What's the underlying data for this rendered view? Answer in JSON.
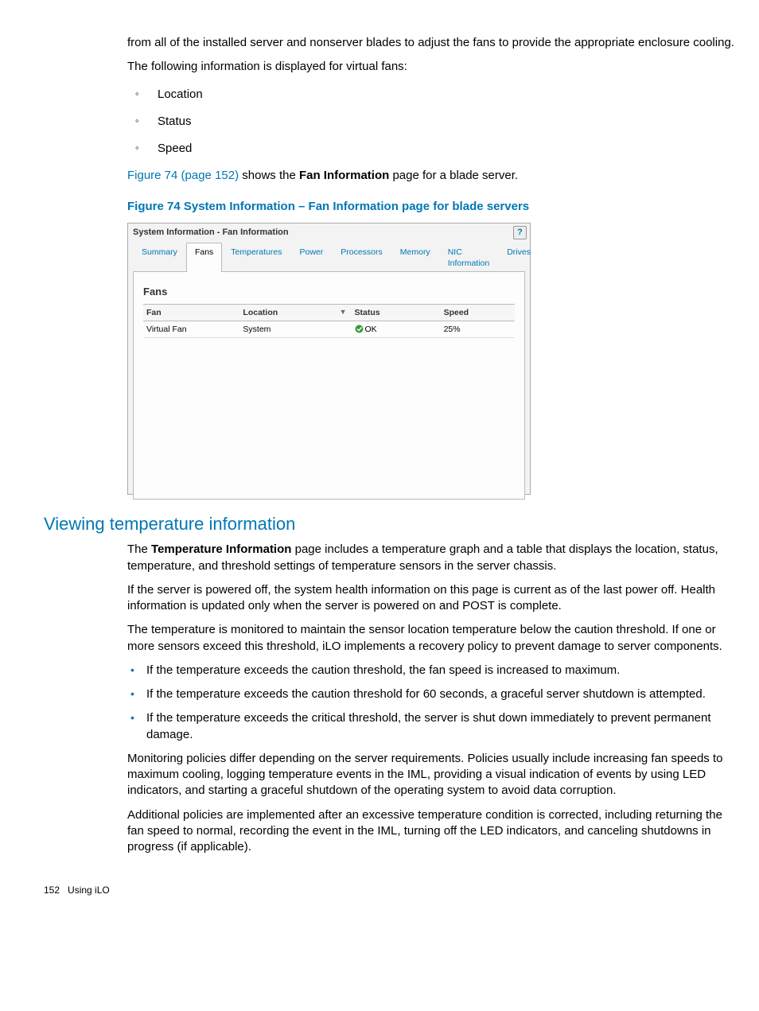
{
  "intro": {
    "p1": "from all of the installed server and nonserver blades to adjust the fans to provide the appropriate enclosure cooling.",
    "p2": "The following information is displayed for virtual fans:",
    "list": [
      "Location",
      "Status",
      "Speed"
    ],
    "p3_pre_link": "",
    "p3_link": "Figure 74 (page 152)",
    "p3_mid": " shows the ",
    "p3_bold": "Fan Information",
    "p3_end": " page for a blade server."
  },
  "figure": {
    "caption": "Figure 74 System Information – Fan Information page for blade servers",
    "title": "System Information - Fan Information",
    "help": "?",
    "tabs": [
      "Summary",
      "Fans",
      "Temperatures",
      "Power",
      "Processors",
      "Memory",
      "NIC Information",
      "Drives"
    ],
    "active_tab_index": 1,
    "section_heading": "Fans",
    "table": {
      "headers": [
        "Fan",
        "Location",
        "Status",
        "Speed"
      ],
      "row": {
        "fan": "Virtual Fan",
        "location": "System",
        "status": "OK",
        "speed": "25%"
      }
    }
  },
  "section": {
    "heading": "Viewing temperature information",
    "p1_pre": "The ",
    "p1_bold": "Temperature Information",
    "p1_post": " page includes a temperature graph and a table that displays the location, status, temperature, and threshold settings of temperature sensors in the server chassis.",
    "p2": "If the server is powered off, the system health information on this page is current as of the last power off. Health information is updated only when the server is powered on and POST is complete.",
    "p3": "The temperature is monitored to maintain the sensor location temperature below the caution threshold. If one or more sensors exceed this threshold, iLO implements a recovery policy to prevent damage to server components.",
    "bullets": [
      "If the temperature exceeds the caution threshold, the fan speed is increased to maximum.",
      "If the temperature exceeds the caution threshold for 60 seconds, a graceful server shutdown is attempted.",
      "If the temperature exceeds the critical threshold, the server is shut down immediately to prevent permanent damage."
    ],
    "p4": "Monitoring policies differ depending on the server requirements. Policies usually include increasing fan speeds to maximum cooling, logging temperature events in the IML, providing a visual indication of events by using LED indicators, and starting a graceful shutdown of the operating system to avoid data corruption.",
    "p5": "Additional policies are implemented after an excessive temperature condition is corrected, including returning the fan speed to normal, recording the event in the IML, turning off the LED indicators, and canceling shutdowns in progress (if applicable)."
  },
  "footer": {
    "page": "152",
    "label": "Using iLO"
  }
}
